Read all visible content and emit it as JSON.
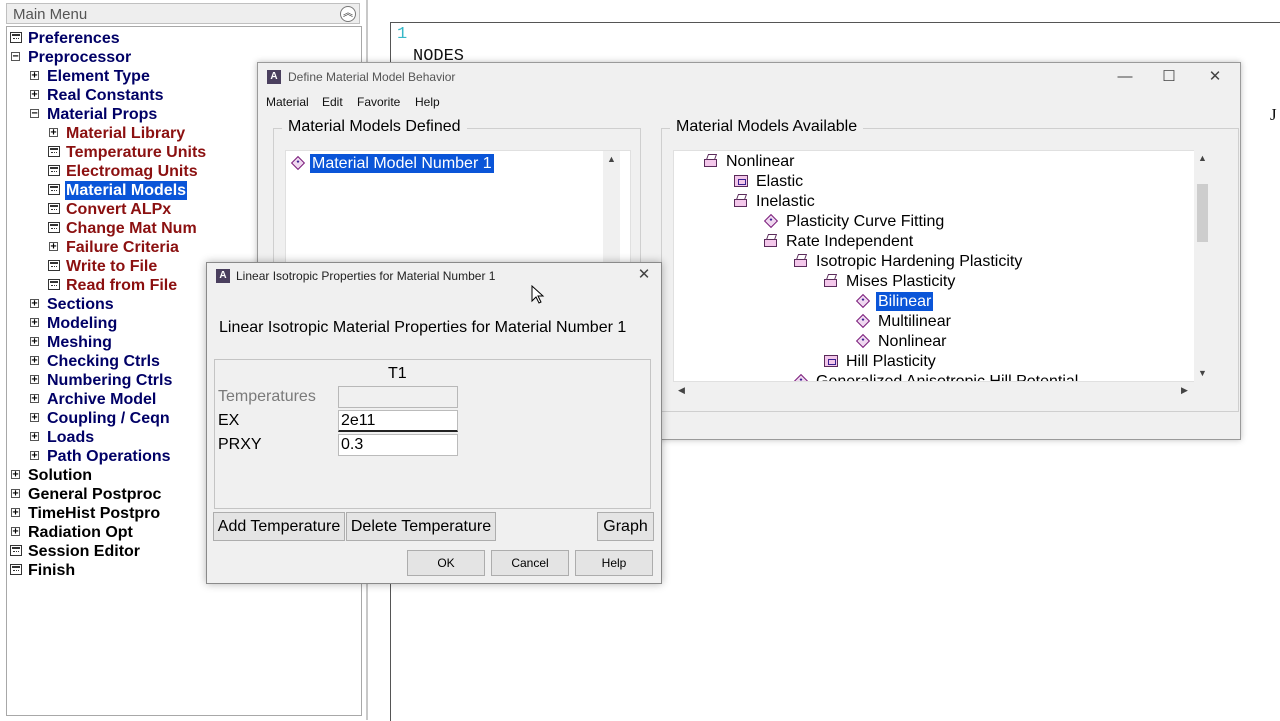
{
  "main_menu": {
    "title": "Main Menu",
    "items": [
      {
        "label": "Preferences",
        "control": "cmd",
        "level": 0,
        "color": "navy"
      },
      {
        "label": "Preprocessor",
        "control": "minus",
        "level": 0,
        "color": "navy"
      },
      {
        "label": "Element Type",
        "control": "plus",
        "level": 1,
        "color": "navy"
      },
      {
        "label": "Real Constants",
        "control": "plus",
        "level": 1,
        "color": "navy"
      },
      {
        "label": "Material Props",
        "control": "minus",
        "level": 1,
        "color": "navy"
      },
      {
        "label": "Material Library",
        "control": "plus",
        "level": 2,
        "color": "red"
      },
      {
        "label": "Temperature Units",
        "control": "cmd",
        "level": 2,
        "color": "red"
      },
      {
        "label": "Electromag Units",
        "control": "cmd",
        "level": 2,
        "color": "red"
      },
      {
        "label": "Material Models",
        "control": "cmd",
        "level": 2,
        "color": "red",
        "selected": true
      },
      {
        "label": "Convert ALPx",
        "control": "cmd",
        "level": 2,
        "color": "red"
      },
      {
        "label": "Change Mat Num",
        "control": "cmd",
        "level": 2,
        "color": "red"
      },
      {
        "label": "Failure Criteria",
        "control": "plus",
        "level": 2,
        "color": "red"
      },
      {
        "label": "Write to File",
        "control": "cmd",
        "level": 2,
        "color": "red"
      },
      {
        "label": "Read from File",
        "control": "cmd",
        "level": 2,
        "color": "red"
      },
      {
        "label": "Sections",
        "control": "plus",
        "level": 1,
        "color": "navy"
      },
      {
        "label": "Modeling",
        "control": "plus",
        "level": 1,
        "color": "navy"
      },
      {
        "label": "Meshing",
        "control": "plus",
        "level": 1,
        "color": "navy"
      },
      {
        "label": "Checking Ctrls",
        "control": "plus",
        "level": 1,
        "color": "navy"
      },
      {
        "label": "Numbering Ctrls",
        "control": "plus",
        "level": 1,
        "color": "navy"
      },
      {
        "label": "Archive Model",
        "control": "plus",
        "level": 1,
        "color": "navy"
      },
      {
        "label": "Coupling / Ceqn",
        "control": "plus",
        "level": 1,
        "color": "navy"
      },
      {
        "label": "Loads",
        "control": "plus",
        "level": 1,
        "color": "navy"
      },
      {
        "label": "Path Operations",
        "control": "plus",
        "level": 1,
        "color": "navy"
      },
      {
        "label": "Solution",
        "control": "plus",
        "level": 0,
        "color": "black"
      },
      {
        "label": "General Postproc",
        "control": "plus",
        "level": 0,
        "color": "black"
      },
      {
        "label": "TimeHist Postpro",
        "control": "plus",
        "level": 0,
        "color": "black"
      },
      {
        "label": "Radiation Opt",
        "control": "plus",
        "level": 0,
        "color": "black"
      },
      {
        "label": "Session Editor",
        "control": "cmd",
        "level": 0,
        "color": "black"
      },
      {
        "label": "Finish",
        "control": "cmd",
        "level": 0,
        "color": "black"
      }
    ]
  },
  "output": {
    "line_number": "1",
    "text": "NODES",
    "right_char": "J"
  },
  "define_window": {
    "title": "Define Material Model Behavior",
    "app_icon_letter": "A",
    "menu": [
      "Material",
      "Edit",
      "Favorite",
      "Help"
    ],
    "controls": {
      "minimize": "—",
      "maximize": "☐",
      "close": "✕"
    },
    "defined": {
      "title": "Material Models Defined",
      "items": [
        {
          "label": "Material Model Number 1",
          "selected": true
        }
      ]
    },
    "available": {
      "title": "Material Models Available",
      "items": [
        {
          "label": "Nonlinear",
          "icon": "open-folder",
          "level": 0
        },
        {
          "label": "Elastic",
          "icon": "closed-folder",
          "level": 1
        },
        {
          "label": "Inelastic",
          "icon": "open-folder",
          "level": 1
        },
        {
          "label": "Plasticity Curve Fitting",
          "icon": "diamond",
          "level": 2
        },
        {
          "label": "Rate Independent",
          "icon": "open-folder",
          "level": 2
        },
        {
          "label": "Isotropic Hardening Plasticity",
          "icon": "open-folder",
          "level": 3
        },
        {
          "label": "Mises Plasticity",
          "icon": "open-folder",
          "level": 4
        },
        {
          "label": "Bilinear",
          "icon": "diamond",
          "level": 5,
          "selected": true
        },
        {
          "label": "Multilinear",
          "icon": "diamond",
          "level": 5
        },
        {
          "label": "Nonlinear",
          "icon": "diamond",
          "level": 5
        },
        {
          "label": "Hill Plasticity",
          "icon": "closed-folder",
          "level": 4
        },
        {
          "label": "Generalized Anisotropic Hill Potential",
          "icon": "diamond",
          "level": 3
        }
      ]
    }
  },
  "linear_dialog": {
    "title": "Linear Isotropic Properties for Material Number 1",
    "app_icon_letter": "A",
    "close": "✕",
    "heading": "Linear Isotropic Material Properties for Material Number 1",
    "column_header": "T1",
    "rows": [
      {
        "label": "Temperatures",
        "value": "",
        "disabled": true
      },
      {
        "label": "EX",
        "value": "2e11",
        "disabled": false
      },
      {
        "label": "PRXY",
        "value": "0.3",
        "disabled": false
      }
    ],
    "buttons": {
      "add_temperature": "Add Temperature",
      "delete_temperature": "Delete Temperature",
      "graph": "Graph",
      "ok": "OK",
      "cancel": "Cancel",
      "help": "Help"
    }
  },
  "colors": {
    "selection": "#0a55d8",
    "menu_navy": "#000066",
    "menu_red": "#8b1010",
    "output_line_number": "#38b8c8"
  }
}
